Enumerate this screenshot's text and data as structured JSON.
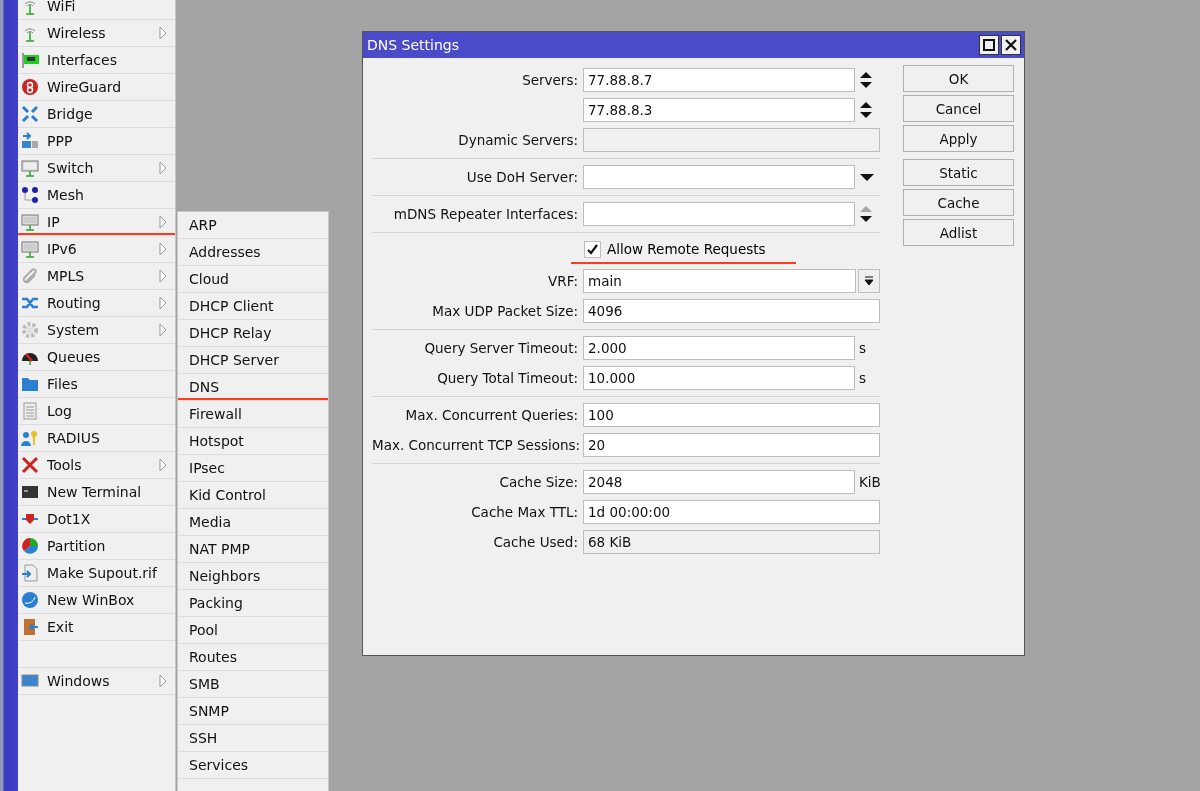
{
  "main_menu": [
    {
      "kind": "item",
      "label": "WiFi",
      "submenu": false,
      "underlined": false
    },
    {
      "kind": "item",
      "label": "Wireless",
      "submenu": true,
      "underlined": false
    },
    {
      "kind": "item",
      "label": "Interfaces",
      "submenu": false,
      "underlined": false
    },
    {
      "kind": "item",
      "label": "WireGuard",
      "submenu": false,
      "underlined": false
    },
    {
      "kind": "item",
      "label": "Bridge",
      "submenu": false,
      "underlined": false
    },
    {
      "kind": "item",
      "label": "PPP",
      "submenu": false,
      "underlined": false
    },
    {
      "kind": "item",
      "label": "Switch",
      "submenu": true,
      "underlined": false
    },
    {
      "kind": "item",
      "label": "Mesh",
      "submenu": false,
      "underlined": false
    },
    {
      "kind": "item",
      "label": "IP",
      "submenu": true,
      "underlined": true
    },
    {
      "kind": "item",
      "label": "IPv6",
      "submenu": true,
      "underlined": false
    },
    {
      "kind": "item",
      "label": "MPLS",
      "submenu": true,
      "underlined": false
    },
    {
      "kind": "item",
      "label": "Routing",
      "submenu": true,
      "underlined": false
    },
    {
      "kind": "item",
      "label": "System",
      "submenu": true,
      "underlined": false
    },
    {
      "kind": "item",
      "label": "Queues",
      "submenu": false,
      "underlined": false
    },
    {
      "kind": "item",
      "label": "Files",
      "submenu": false,
      "underlined": false
    },
    {
      "kind": "item",
      "label": "Log",
      "submenu": false,
      "underlined": false
    },
    {
      "kind": "item",
      "label": "RADIUS",
      "submenu": false,
      "underlined": false
    },
    {
      "kind": "item",
      "label": "Tools",
      "submenu": true,
      "underlined": false
    },
    {
      "kind": "item",
      "label": "New Terminal",
      "submenu": false,
      "underlined": false
    },
    {
      "kind": "item",
      "label": "Dot1X",
      "submenu": false,
      "underlined": false
    },
    {
      "kind": "item",
      "label": "Partition",
      "submenu": false,
      "underlined": false
    },
    {
      "kind": "item",
      "label": "Make Supout.rif",
      "submenu": false,
      "underlined": false
    },
    {
      "kind": "item",
      "label": "New WinBox",
      "submenu": false,
      "underlined": false
    },
    {
      "kind": "item",
      "label": "Exit",
      "submenu": false,
      "underlined": false
    },
    {
      "kind": "separator"
    },
    {
      "kind": "item",
      "label": "Windows",
      "submenu": true,
      "underlined": false
    }
  ],
  "ip_submenu": [
    {
      "label": "ARP",
      "underlined": false
    },
    {
      "label": "Addresses",
      "underlined": false
    },
    {
      "label": "Cloud",
      "underlined": false
    },
    {
      "label": "DHCP Client",
      "underlined": false
    },
    {
      "label": "DHCP Relay",
      "underlined": false
    },
    {
      "label": "DHCP Server",
      "underlined": false
    },
    {
      "label": "DNS",
      "underlined": true
    },
    {
      "label": "Firewall",
      "underlined": false
    },
    {
      "label": "Hotspot",
      "underlined": false
    },
    {
      "label": "IPsec",
      "underlined": false
    },
    {
      "label": "Kid Control",
      "underlined": false
    },
    {
      "label": "Media",
      "underlined": false
    },
    {
      "label": "NAT PMP",
      "underlined": false
    },
    {
      "label": "Neighbors",
      "underlined": false
    },
    {
      "label": "Packing",
      "underlined": false
    },
    {
      "label": "Pool",
      "underlined": false
    },
    {
      "label": "Routes",
      "underlined": false
    },
    {
      "label": "SMB",
      "underlined": false
    },
    {
      "label": "SNMP",
      "underlined": false
    },
    {
      "label": "SSH",
      "underlined": false
    },
    {
      "label": "Services",
      "underlined": false
    }
  ],
  "dialog": {
    "title": "DNS Settings",
    "sections": [
      [
        {
          "kind": "list",
          "label": "Servers:",
          "value": "77.88.8.7"
        },
        {
          "kind": "list",
          "value": "77.88.8.3"
        },
        {
          "kind": "readonly",
          "label": "Dynamic Servers:"
        }
      ],
      [
        {
          "kind": "dropdown",
          "label": "Use DoH Server:"
        }
      ],
      [
        {
          "kind": "list",
          "label": "mDNS Repeater Interfaces:"
        }
      ],
      [
        {
          "kind": "checkbox",
          "label": "Allow Remote Requests",
          "checked": true,
          "underlined": true
        },
        {
          "kind": "select",
          "label": "VRF:",
          "value": "main"
        },
        {
          "kind": "text",
          "label": "Max UDP Packet Size:",
          "value": "4096"
        }
      ],
      [
        {
          "kind": "text",
          "label": "Query Server Timeout:",
          "value": "2.000",
          "unit": "s"
        },
        {
          "kind": "text",
          "label": "Query Total Timeout:",
          "value": "10.000",
          "unit": "s"
        }
      ],
      [
        {
          "kind": "text",
          "label": "Max. Concurrent Queries:",
          "value": "100"
        },
        {
          "kind": "text",
          "label": "Max. Concurrent TCP Sessions:",
          "value": "20"
        }
      ],
      [
        {
          "kind": "text",
          "label": "Cache Size:",
          "value": "2048",
          "unit": "KiB"
        },
        {
          "kind": "text",
          "label": "Cache Max TTL:",
          "value": "1d 00:00:00"
        },
        {
          "kind": "readonly",
          "label": "Cache Used:",
          "value": "68 KiB"
        }
      ]
    ],
    "button_groups": [
      [
        "OK",
        "Cancel",
        "Apply"
      ],
      [
        "Static",
        "Cache",
        "Adlist"
      ]
    ]
  }
}
